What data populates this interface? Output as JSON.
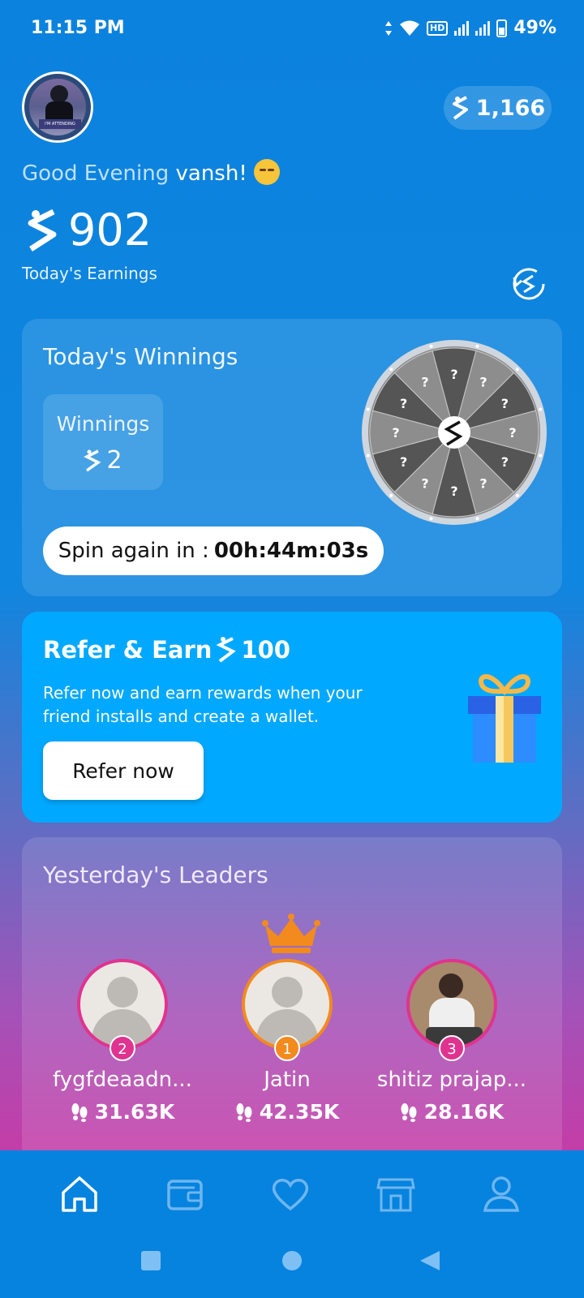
{
  "status": {
    "time": "11:15 PM",
    "battery": "49%",
    "network_badge": "HD"
  },
  "header": {
    "coins": "1,166",
    "greeting_prefix": "Good Evening",
    "user_name": "vansh!",
    "avatar_banner": "I'M ATTENDING",
    "greeting_emoji": "sleepy-face-icon"
  },
  "earnings": {
    "value": "902",
    "label": "Today's Earnings"
  },
  "winnings_card": {
    "title": "Today's Winnings",
    "box_label": "Winnings",
    "box_value": "2",
    "spin_prefix": "Spin again in :",
    "spin_timer": "00h:44m:03s",
    "wheel_segment_count": 12,
    "wheel_segment_label": "?"
  },
  "refer_card": {
    "title": "Refer & Earn",
    "reward": "100",
    "description": "Refer now and earn rewards when your friend installs and create a wallet.",
    "button_label": "Refer now"
  },
  "leaders_card": {
    "title": "Yesterday's Leaders",
    "leaders": [
      {
        "rank": "2",
        "name": "fygfdeaadn...",
        "steps": "31.63K",
        "avatar": "default"
      },
      {
        "rank": "1",
        "name": "Jatin",
        "steps": "42.35K",
        "avatar": "default"
      },
      {
        "rank": "3",
        "name": "shitiz prajap...",
        "steps": "28.16K",
        "avatar": "photo"
      }
    ]
  },
  "bottom_nav": {
    "items": [
      "home-icon",
      "wallet-icon",
      "heart-icon",
      "store-icon",
      "profile-icon"
    ],
    "active": "home-icon"
  },
  "colors": {
    "primary_blue": "#0b82de",
    "refer_blue": "#00a8ff",
    "accent_pink": "#e0338f",
    "accent_orange": "#f28a1e"
  }
}
